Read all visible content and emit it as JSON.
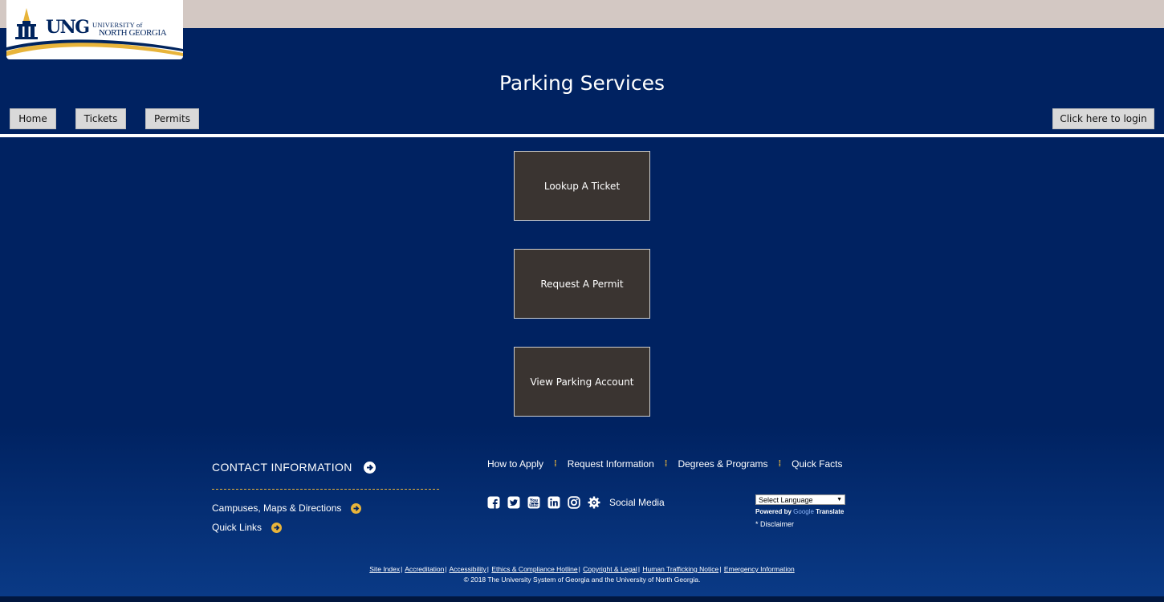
{
  "header": {
    "logo_ung": "UNG",
    "logo_university": "UNIVERSITY of",
    "logo_north_georgia": "NORTH GEORGIA",
    "title": "Parking Services",
    "nav": {
      "home": "Home",
      "tickets": "Tickets",
      "permits": "Permits",
      "login": "Click here to login"
    }
  },
  "main": {
    "tiles": [
      "Lookup A Ticket",
      "Request A Permit",
      "View Parking Account"
    ]
  },
  "footer": {
    "contact_title": "CONTACT INFORMATION",
    "campuses_link": "Campuses, Maps & Directions",
    "quick_links": "Quick Links",
    "top_links": [
      "How to Apply",
      "Request Information",
      "Degrees & Programs",
      "Quick Facts"
    ],
    "social_label": "Social Media",
    "language_select": "Select Language",
    "powered_by": "Powered by",
    "google": "Google",
    "translate": "Translate",
    "disclaimer": "Disclaimer",
    "legal_links": [
      "Site Index",
      "Accreditation",
      "Accessibility",
      "Ethics & Compliance Hotline",
      "Copyright & Legal",
      "Human Trafficking Notice",
      "Emergency Information"
    ],
    "copyright": "© 2018 The University System of Georgia and the University of North Georgia."
  },
  "colors": {
    "navy": "#002261",
    "tile_bg": "#3a3431",
    "gold": "#e8b43a",
    "topbar": "#d3c8c3"
  }
}
